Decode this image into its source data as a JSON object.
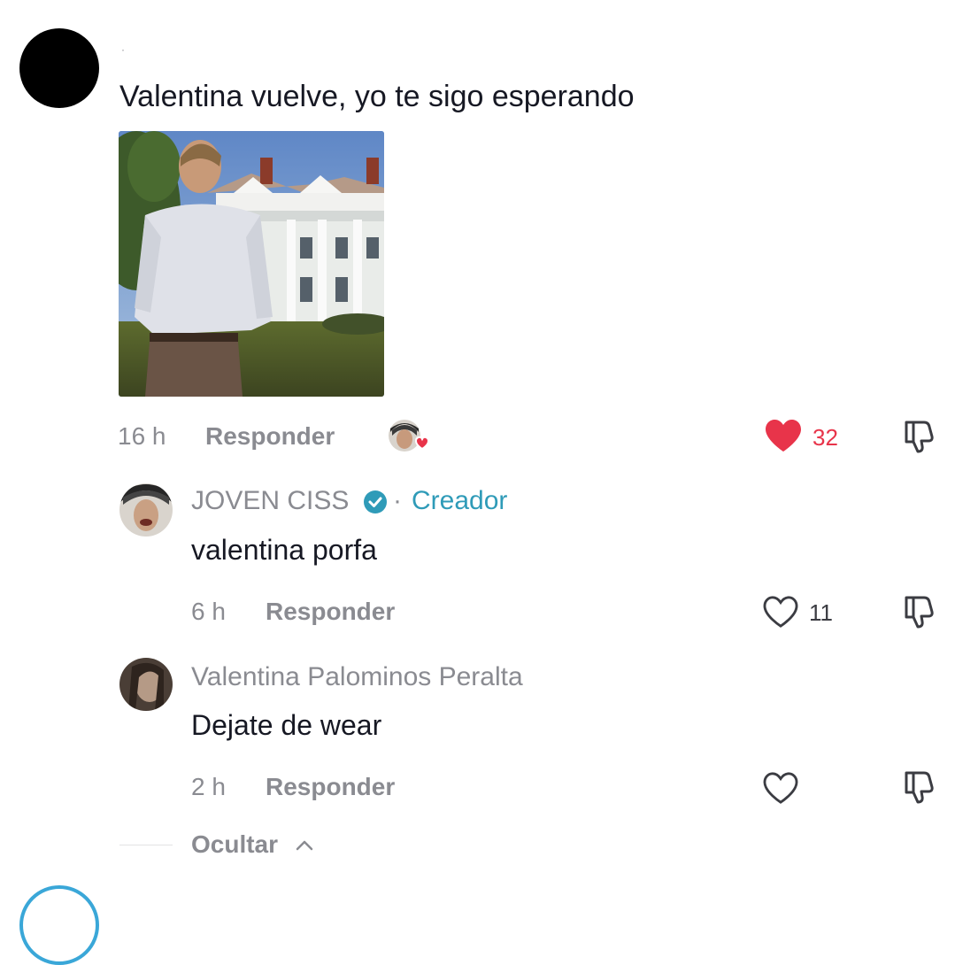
{
  "main_comment": {
    "text": "Valentina vuelve, yo te sigo esperando",
    "dot": "·",
    "time": "16 h",
    "reply_label": "Responder",
    "likes": "32",
    "liked": true
  },
  "replies": [
    {
      "author": "JOVEN CISS",
      "verified": true,
      "separator": "·",
      "role": "Creador",
      "text": "valentina porfa",
      "time": "6 h",
      "reply_label": "Responder",
      "likes": "11"
    },
    {
      "author": "Valentina Palominos Peralta",
      "text": "Dejate de wear",
      "time": "2 h",
      "reply_label": "Responder",
      "likes": ""
    }
  ],
  "hide_label": "Ocultar",
  "icons": {
    "like": "heart-icon",
    "dislike": "thumbs-down-icon",
    "verified": "verified-check-icon",
    "chevron": "chevron-up-icon",
    "creator_liked": "creator-liked-badge-icon"
  },
  "colors": {
    "like_red": "#e8344a",
    "creator_teal": "#2f9bb8",
    "muted_gray": "#8a8b91"
  }
}
